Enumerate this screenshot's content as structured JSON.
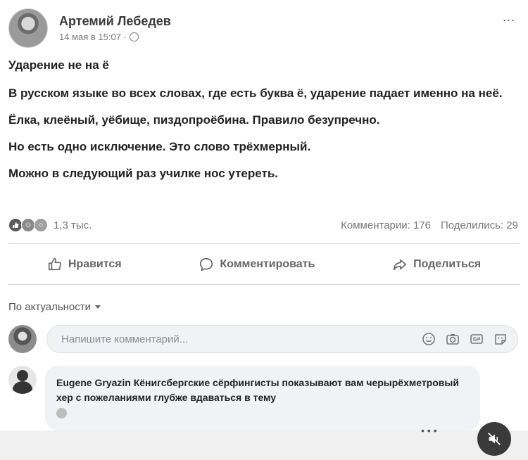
{
  "post": {
    "author": "Артемий Лебедев",
    "date": "14 мая в 15:07 ·",
    "more": "...",
    "title": "Ударение не на ё",
    "paragraphs": [
      "В русском языке во всех словах, где есть буква ё, ударение падает именно на неё.",
      "Ёлка, клеёный, уёбище, пиздопроёбина. Правило безупречно.",
      "Но есть одно исключение. Это слово трёхмерный.",
      "Можно в следующий раз училке нос утереть."
    ]
  },
  "stats": {
    "reactions_count": "1,3 тыс.",
    "comments": "Комментарии: 176",
    "shares": "Поделились: 29"
  },
  "actions": {
    "like": "Нравится",
    "comment": "Комментировать",
    "share": "Поделиться"
  },
  "sort": {
    "label": "По актуальности"
  },
  "composer": {
    "placeholder": "Напишите комментарий..."
  },
  "comment": {
    "name": "Eugene Gryazin",
    "text": "Кёнигсбергские сёрфингисты показывают вам черырёхметровый хер с пожеланиями глубже вдаваться в тему"
  },
  "colors": {
    "divider": "#d6d6d6",
    "bubble": "#f0f2f5"
  }
}
